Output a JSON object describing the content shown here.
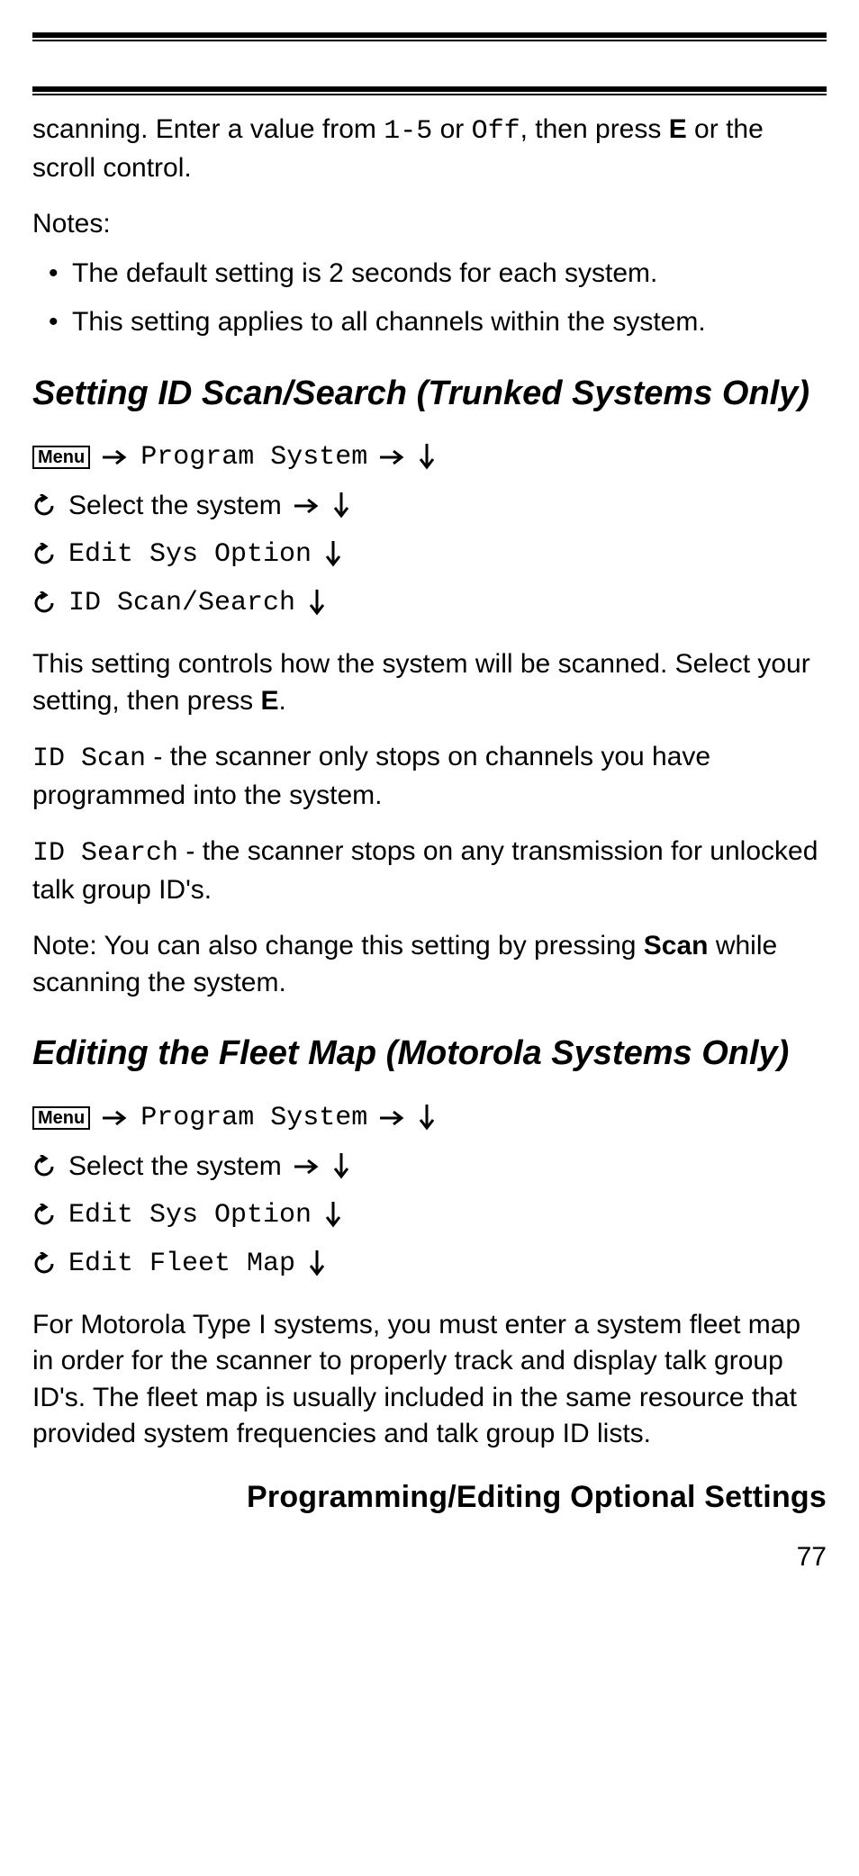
{
  "intro": {
    "p1_a": "scanning. Enter a value from ",
    "p1_range": "1-5",
    "p1_b": " or ",
    "p1_off": "Off",
    "p1_c": ", then press ",
    "p1_key": "E",
    "p1_d": " or the scroll control."
  },
  "notes": {
    "label": "Notes:",
    "items": [
      "The default setting is 2 seconds for each system.",
      "This setting applies to all channels within the system."
    ]
  },
  "section1": {
    "title": "Setting ID Scan/Search (Trunked Systems Only)",
    "nav": {
      "menu": "Menu",
      "program_system": "Program System",
      "select_system": "Select the system",
      "edit_sys_option": "Edit Sys Option",
      "last": "ID Scan/Search"
    },
    "p1_a": "This setting controls how the system will be scanned. Select your setting, then press ",
    "p1_key": "E",
    "p1_b": ".",
    "idscan_label": "ID Scan",
    "idscan_desc": " - the scanner only stops on channels you have programmed into the system.",
    "idsearch_label": "ID Search",
    "idsearch_desc": " - the scanner stops on any transmission for unlocked talk group ID's.",
    "note_a": "Note: You can also change this setting by pressing ",
    "note_key": "Scan",
    "note_b": " while scanning the system."
  },
  "section2": {
    "title": "Editing the Fleet Map (Motorola Systems Only)",
    "nav": {
      "menu": "Menu",
      "program_system": "Program System",
      "select_system": "Select the system",
      "edit_sys_option": "Edit Sys Option",
      "last": "Edit Fleet Map"
    },
    "p1": "For Motorola Type I systems, you must enter a system fleet map in order for the scanner to properly track and display talk group ID's. The fleet map is usually included in the same resource that provided system frequencies and talk group ID lists."
  },
  "footer": {
    "heading": "Programming/Editing Optional Settings",
    "page": "77"
  }
}
